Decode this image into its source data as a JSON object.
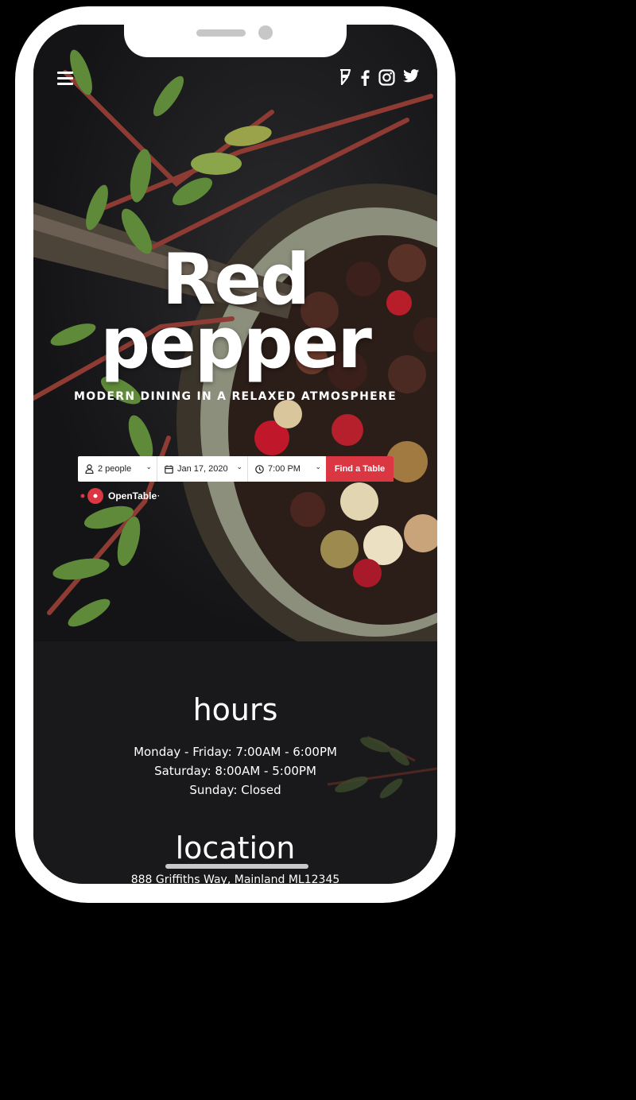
{
  "brand": {
    "title_line1": "Red",
    "title_line2": "pepper",
    "tagline": "MODERN DINING IN A RELAXED ATMOSPHERE"
  },
  "nav": {
    "menu_icon": "hamburger-menu-icon",
    "social": [
      "foursquare-icon",
      "facebook-icon",
      "instagram-icon",
      "twitter-icon"
    ]
  },
  "booking": {
    "party_size": "2 people",
    "date": "Jan 17, 2020",
    "time": "7:00 PM",
    "find_button": "Find a Table",
    "provider": "OpenTable",
    "provider_mark": "·",
    "accent_color": "#da3743"
  },
  "hours": {
    "heading": "hours",
    "lines": [
      "Monday - Friday: 7:00AM - 6:00PM",
      "Saturday: 8:00AM - 5:00PM",
      "Sunday: Closed"
    ]
  },
  "location": {
    "heading": "location",
    "address": "888 Griffiths Way, Mainland ML12345"
  }
}
